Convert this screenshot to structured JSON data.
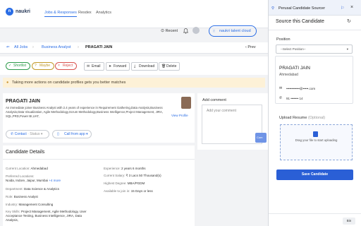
{
  "top_nav": {
    "brand": "naukri",
    "items": [
      "Jobs & Responses",
      "Resdex",
      "Analytics"
    ],
    "recent_label": "Recent",
    "cloud_label": "naukri talent cloud"
  },
  "breadcrumb": {
    "all_jobs": "All Jobs",
    "job": "Business Analyst",
    "candidate": "PRAGATI JAIN",
    "prev": "Prev"
  },
  "actions": {
    "shortlist": "Shortlist",
    "maybe": "Maybe",
    "reject": "Reject",
    "email": "Email",
    "forward": "Forward",
    "download": "Download",
    "delete": "Delete"
  },
  "tip": "Taking more actions on candidate profiles gets you better matches",
  "candidate": {
    "name": "PRAGATI JAIN",
    "summary": "An immediate joiner Business Analyst with 2.4 years of experience in Requirement Gathering,Data Analysis,Business Analysis,Data Visualization, Agile Methodology,Scrum Methodology,Business Intelligence,Project Management, JIRA, SQL,PRD,Power BI,UAT,",
    "view_profile": "View Profile",
    "contact_label": "Contact",
    "status_label": "Status",
    "call_label": "Call from app"
  },
  "details": {
    "title": "Candidate Details",
    "left": [
      {
        "label": "Current Location:",
        "value": "Ahmedabad"
      },
      {
        "label": "Preferred Locations:",
        "value": "Noida, Indore, Jaipur, Mumbai",
        "more": "+4 more"
      },
      {
        "label": "Department:",
        "value": "Data Science & Analytics"
      },
      {
        "label": "Role:",
        "value": "Business Analyst"
      },
      {
        "label": "Industry:",
        "value": "Management Consulting"
      },
      {
        "label": "Key Skills:",
        "value": "Project Management, Agile Methodology, User Acceptance Testing, Business Intelligence, JIRA, Data Analysis,"
      }
    ],
    "right": [
      {
        "label": "Experience:",
        "value": "2 years 6 months"
      },
      {
        "label": "Current Salary:",
        "value": "₹ 3 Lacs 50 Thousand(s)"
      },
      {
        "label": "Highest Degree:",
        "value": "MBA/PGDM"
      },
      {
        "label": "Available to join in:",
        "value": "15 Days or less"
      }
    ]
  },
  "comment": {
    "heading": "Add comment",
    "placeholder": "Add your comment",
    "button": "Com"
  },
  "panel": {
    "title": "Perusal Candidate Sourcer",
    "subtitle": "Source this Candidate",
    "position_label": "Position",
    "position_placeholder": "--Select Position--",
    "candidate_name": "PRAGATI JAIN",
    "candidate_city": "Ahmedabad",
    "email_masked": "••••••••••••@•••••.com",
    "phone_masked": "91 ••••••• 14",
    "upload_label": "Upload Resume",
    "upload_optional": "(Optional)",
    "upload_hint": "Drag your file to start uploading",
    "save_button": "Save Candidate",
    "bottom_pill": "Bin"
  },
  "colors": {
    "accent": "#2a6de5",
    "save_button": "#2a5fd6",
    "shortlist": "#2e9b4a",
    "maybe": "#c29a2a",
    "reject": "#d9534f",
    "tip_bg": "#fdf1d7"
  }
}
